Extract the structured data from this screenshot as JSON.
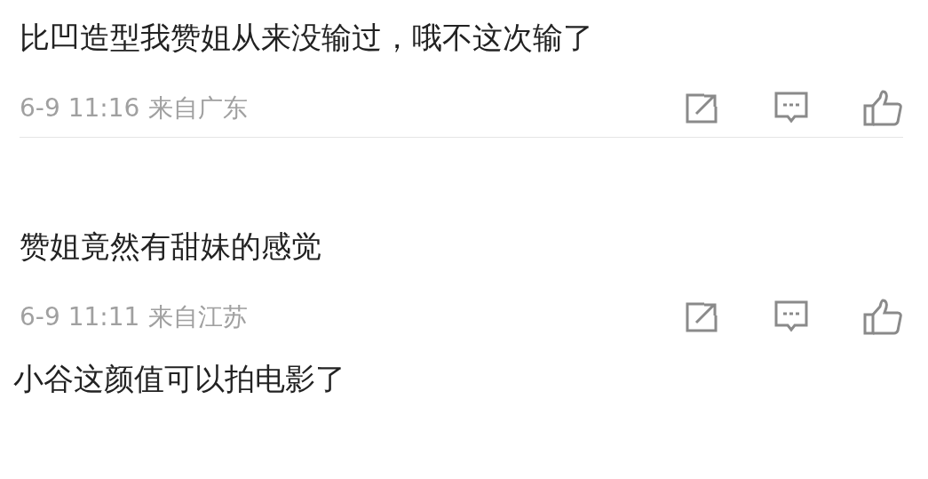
{
  "comments": [
    {
      "text": "比凹造型我赞姐从来没输过，哦不这次输了",
      "time": "6-9 11:16",
      "location": "来自广东",
      "divider": true
    },
    {
      "text": "赞姐竟然有甜妹的感觉",
      "time": "6-9 11:11",
      "location": "来自江苏",
      "divider": false
    },
    {
      "text": "小谷这颜值可以拍电影了"
    }
  ]
}
